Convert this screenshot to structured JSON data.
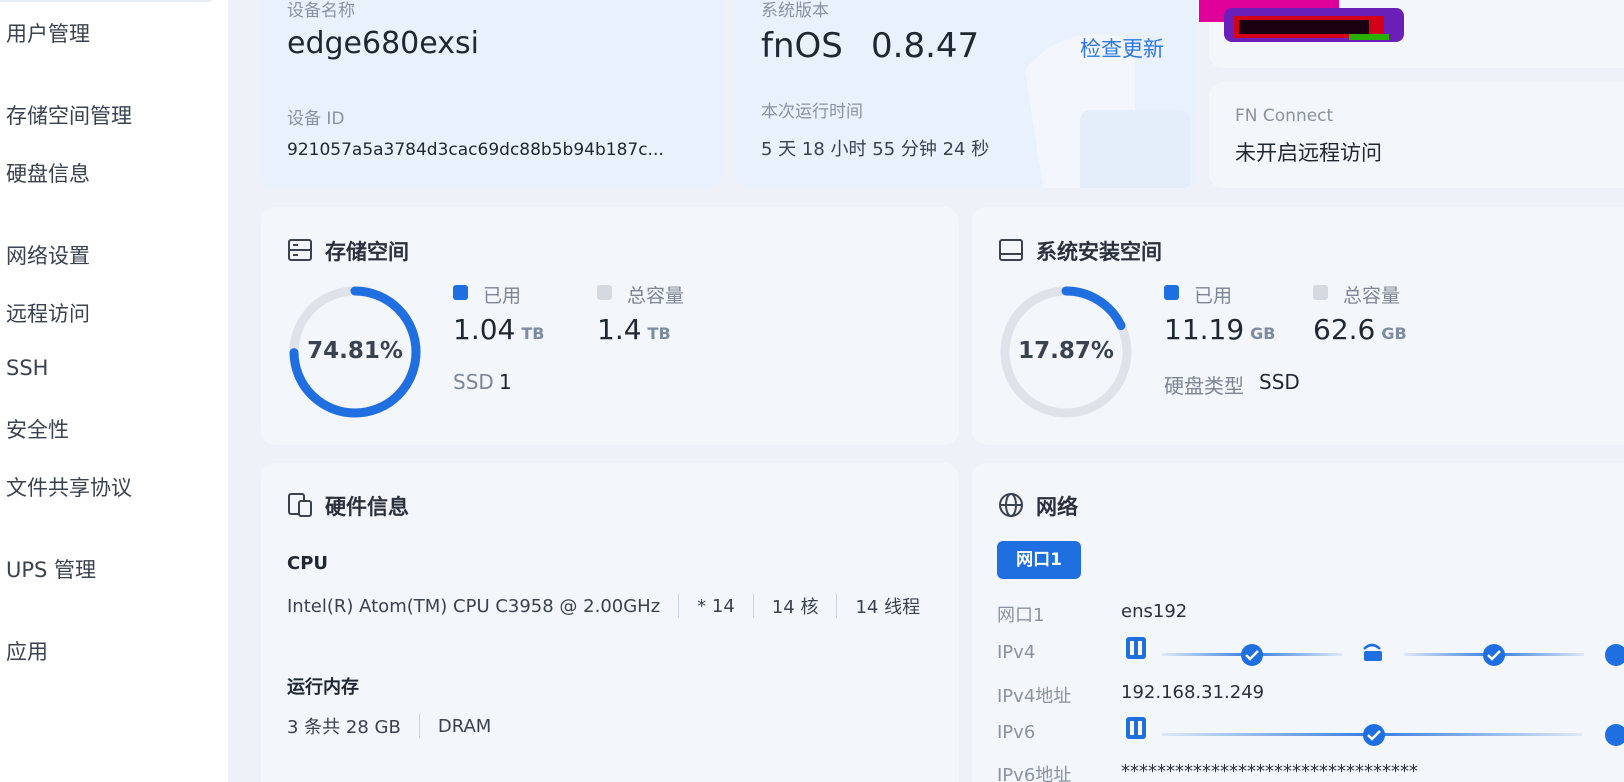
{
  "sidebar": {
    "items": [
      {
        "label": "用户管理"
      },
      {
        "label": "存储空间管理"
      },
      {
        "label": "硬盘信息"
      },
      {
        "label": "网络设置"
      },
      {
        "label": "远程访问"
      },
      {
        "label": "SSH"
      },
      {
        "label": "安全性"
      },
      {
        "label": "文件共享协议"
      },
      {
        "label": "UPS 管理"
      },
      {
        "label": "应用"
      }
    ]
  },
  "device": {
    "name_label": "设备名称",
    "name": "edge680exsi",
    "id_label": "设备 ID",
    "id": "921057a5a3784d3cac69dc88b5b94b187c..."
  },
  "system": {
    "version_label": "系统版本",
    "os": "fnOS",
    "version": "0.8.47",
    "check_update": "检查更新",
    "uptime_label": "本次运行时间",
    "uptime": "5 天 18 小时 55 分钟 24 秒"
  },
  "fn_connect": {
    "label": "FN Connect",
    "status": "未开启远程访问"
  },
  "storage": {
    "title": "存储空间",
    "percent_text": "74.81%",
    "percent": 74.81,
    "used_label": "已用",
    "used_value": "1.04",
    "used_unit": "TB",
    "total_label": "总容量",
    "total_value": "1.4",
    "total_unit": "TB",
    "ssd_label": "SSD",
    "ssd_count": "1"
  },
  "sys_install": {
    "title": "系统安装空间",
    "percent_text": "17.87%",
    "percent": 17.87,
    "used_label": "已用",
    "used_value": "11.19",
    "used_unit": "GB",
    "total_label": "总容量",
    "total_value": "62.6",
    "total_unit": "GB",
    "disk_type_label": "硬盘类型",
    "disk_type": "SSD"
  },
  "hardware": {
    "title": "硬件信息",
    "cpu_label": "CPU",
    "cpu_model": "Intel(R) Atom(TM) CPU C3958 @ 2.00GHz",
    "cpu_count": "* 14",
    "cpu_cores": "14 核",
    "cpu_threads": "14 线程",
    "mem_label": "运行内存",
    "mem_size": "3 条共 28 GB",
    "mem_type": "DRAM"
  },
  "network": {
    "title": "网络",
    "port_tab": "网口1",
    "port_label": "网口1",
    "port_value": "ens192",
    "ipv4_label": "IPv4",
    "ipv4_addr_label": "IPv4地址",
    "ipv4_addr": "192.168.31.249",
    "ipv6_label": "IPv6",
    "ipv6_addr_label": "IPv6地址",
    "ipv6_addr": "*********************************"
  },
  "colors": {
    "accent": "#1f6fe0",
    "ring_track": "#dfe2e8",
    "legend_total": "#d5d9e0"
  }
}
